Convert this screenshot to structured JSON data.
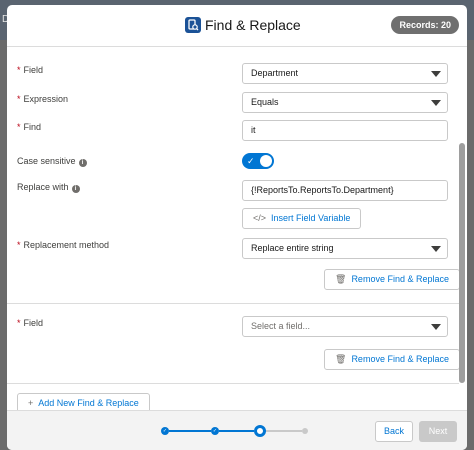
{
  "backdrop": {
    "letter": "D"
  },
  "header": {
    "title": "Find & Replace",
    "badge": "Records: 20"
  },
  "group1": {
    "field": {
      "label": "Field",
      "value": "Department"
    },
    "expression": {
      "label": "Expression",
      "value": "Equals"
    },
    "find": {
      "label": "Find",
      "value": "it"
    },
    "case_sensitive": {
      "label": "Case sensitive",
      "checked": true
    },
    "replace_with": {
      "label": "Replace with",
      "value": "{!ReportsTo.ReportsTo.Department}"
    },
    "insert_variable_label": "Insert Field Variable",
    "replacement_method": {
      "label": "Replacement method",
      "value": "Replace entire string"
    },
    "remove_label": "Remove Find & Replace"
  },
  "group2": {
    "field": {
      "label": "Field",
      "placeholder": "Select a field..."
    },
    "remove_label": "Remove Find & Replace"
  },
  "add_new_label": "Add New Find & Replace",
  "footer": {
    "back_label": "Back",
    "next_label": "Next",
    "steps": [
      "done",
      "done",
      "current",
      "todo"
    ]
  },
  "colors": {
    "brand": "#0176d3",
    "required": "#ba0517",
    "badge": "#6f6f6f"
  }
}
